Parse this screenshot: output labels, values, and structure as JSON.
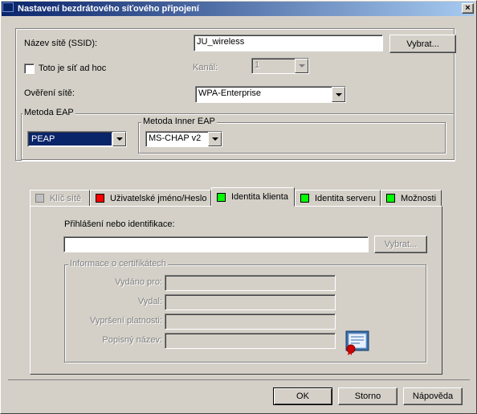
{
  "window": {
    "title": "Nastavení bezdrátového síťového připojení",
    "close_label": "×"
  },
  "network": {
    "ssid_label": "Název sítě (SSID):",
    "ssid_value": "JU_wireless",
    "select_button": "Vybrat...",
    "adhoc_label": "Toto je síť ad hoc",
    "channel_label": "Kanál:",
    "channel_value": "1",
    "auth_label": "Ověření sítě:",
    "auth_value": "WPA-Enterprise"
  },
  "eap": {
    "group_label": "Metoda EAP",
    "value": "PEAP",
    "inner_group_label": "Metoda Inner EAP",
    "inner_value": "MS-CHAP v2"
  },
  "tabs": [
    {
      "label": "Klíč sítě",
      "color": "#c0c0c0",
      "disabled": true
    },
    {
      "label": "Uživatelské jméno/Heslo",
      "color": "#ff0000"
    },
    {
      "label": "Identita klienta",
      "color": "#00ff00"
    },
    {
      "label": "Identita serveru",
      "color": "#00ff00"
    },
    {
      "label": "Možnosti",
      "color": "#00ff00"
    }
  ],
  "identity": {
    "login_label": "Přihlášení nebo identifikace:",
    "login_value": "",
    "select_button": "Vybrat...",
    "cert_group_label": "Informace o certifikátech",
    "issued_to_label": "Vydáno pro:",
    "issued_by_label": "Vydal:",
    "expires_label": "Vypršení platnosti:",
    "friendly_name_label": "Popisný název:",
    "cert_icon": "certificate-icon"
  },
  "buttons": {
    "ok": "OK",
    "cancel": "Storno",
    "help": "Nápověda"
  }
}
